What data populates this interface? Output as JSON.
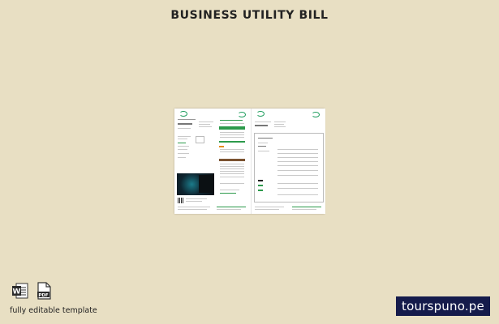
{
  "header": {
    "title": "BUSINESS UTILITY BILL"
  },
  "footer": {
    "caption": "fully editable template",
    "brand": "tourspuno.pe"
  },
  "icons": {
    "word": "word-doc-icon",
    "pdf": "pdf-doc-icon",
    "pdf_label": "PDF"
  },
  "colors": {
    "background": "#e8dfc3",
    "brand_bg": "#151b4b",
    "accent_green": "#2c9a4b",
    "accent_orange": "#e58b1c",
    "word_blue": "#2b579a"
  }
}
